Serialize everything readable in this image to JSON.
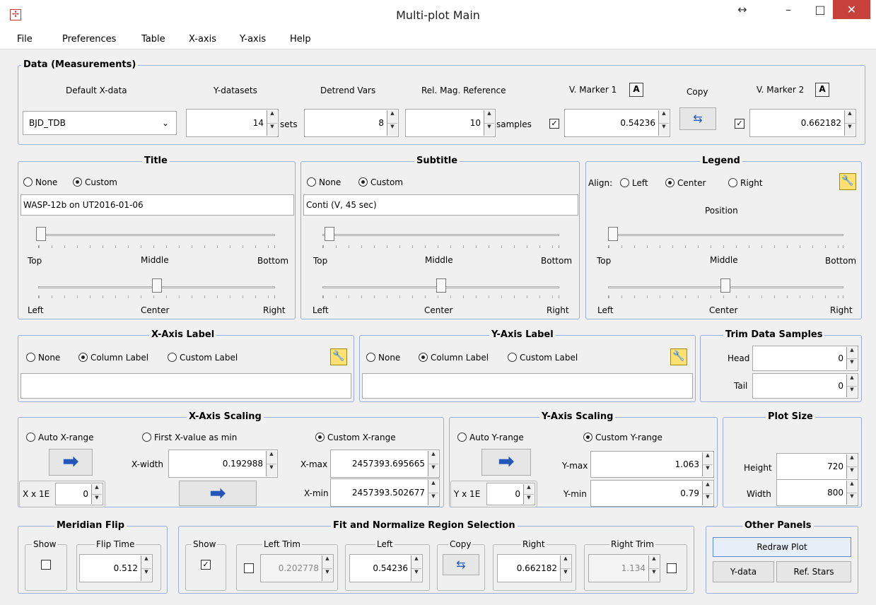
{
  "window": {
    "title": "Multi-plot Main",
    "resize_glyph": "↔",
    "min_glyph": "–",
    "max_glyph": "□",
    "close_glyph": "✕"
  },
  "menu": [
    "File",
    "Preferences",
    "Table",
    "X-axis",
    "Y-axis",
    "Help"
  ],
  "data": {
    "title": "Data (Measurements)",
    "default_x_label": "Default X-data",
    "default_x_value": "BJD_TDB",
    "ydatasets_label": "Y-datasets",
    "ydatasets_value": "14",
    "sets_unit": "sets",
    "detrend_label": "Detrend Vars",
    "detrend_value": "8",
    "relmag_label": "Rel. Mag. Reference",
    "relmag_value": "10",
    "samples_unit": "samples",
    "vmarker1_label": "V. Marker 1",
    "vmarker1_value": "0.54236",
    "copy_label": "Copy",
    "vmarker2_label": "V. Marker 2",
    "vmarker2_value": "0.662182",
    "a_glyph": "A"
  },
  "title_panel": {
    "title": "Title",
    "none": "None",
    "custom": "Custom",
    "value": "WASP-12b on UT2016-01-06",
    "top": "Top",
    "middle": "Middle",
    "bottom": "Bottom",
    "left": "Left",
    "center": "Center",
    "right": "Right"
  },
  "subtitle_panel": {
    "title": "Subtitle",
    "none": "None",
    "custom": "Custom",
    "value": "Conti  (V, 45 sec)",
    "top": "Top",
    "middle": "Middle",
    "bottom": "Bottom",
    "left": "Left",
    "center": "Center",
    "right": "Right"
  },
  "legend_panel": {
    "title": "Legend",
    "align": "Align:",
    "left_opt": "Left",
    "center_opt": "Center",
    "right_opt": "Right",
    "position": "Position",
    "top": "Top",
    "middle": "Middle",
    "bottom": "Bottom",
    "left": "Left",
    "center": "Center",
    "right": "Right"
  },
  "xlabel_panel": {
    "title": "X-Axis Label",
    "none": "None",
    "column": "Column Label",
    "custom": "Custom Label",
    "value": ""
  },
  "ylabel_panel": {
    "title": "Y-Axis Label",
    "none": "None",
    "column": "Column Label",
    "custom": "Custom Label",
    "value": ""
  },
  "trim_panel": {
    "title": "Trim Data Samples",
    "head": "Head",
    "head_value": "0",
    "tail": "Tail",
    "tail_value": "0"
  },
  "xscale": {
    "title": "X-Axis Scaling",
    "auto": "Auto X-range",
    "first": "First X-value as min",
    "custom": "Custom X-range",
    "xwidth_label": "X-width",
    "xwidth_value": "0.192988",
    "xmax_label": "X-max",
    "xmax_value": "2457393.695665",
    "xmin_label": "X-min",
    "xmin_value": "2457393.502677",
    "x1e_label": "X x 1E",
    "x1e_value": "0"
  },
  "yscale": {
    "title": "Y-Axis Scaling",
    "auto": "Auto Y-range",
    "custom": "Custom Y-range",
    "ymax_label": "Y-max",
    "ymax_value": "1.063",
    "ymin_label": "Y-min",
    "ymin_value": "0.79",
    "y1e_label": "Y x 1E",
    "y1e_value": "0"
  },
  "plotsize": {
    "title": "Plot Size",
    "height_label": "Height",
    "height_value": "720",
    "width_label": "Width",
    "width_value": "800"
  },
  "meridian": {
    "title": "Meridian Flip",
    "show": "Show",
    "fliptime": "Flip Time",
    "fliptime_value": "0.512"
  },
  "fit": {
    "title": "Fit and Normalize Region Selection",
    "show": "Show",
    "check": "✓",
    "lefttrim": "Left Trim",
    "lefttrim_value": "0.202778",
    "left": "Left",
    "left_value": "0.54236",
    "copy": "Copy",
    "right": "Right",
    "right_value": "0.662182",
    "righttrim": "Right Trim",
    "righttrim_value": "1.134"
  },
  "other": {
    "title": "Other Panels",
    "redraw": "Redraw Plot",
    "ydata": "Y-data",
    "refstars": "Ref. Stars"
  },
  "icons": {
    "arrow": "arrow-right-icon",
    "wrench": "wrench-icon",
    "swap": "swap-arrows-icon"
  }
}
